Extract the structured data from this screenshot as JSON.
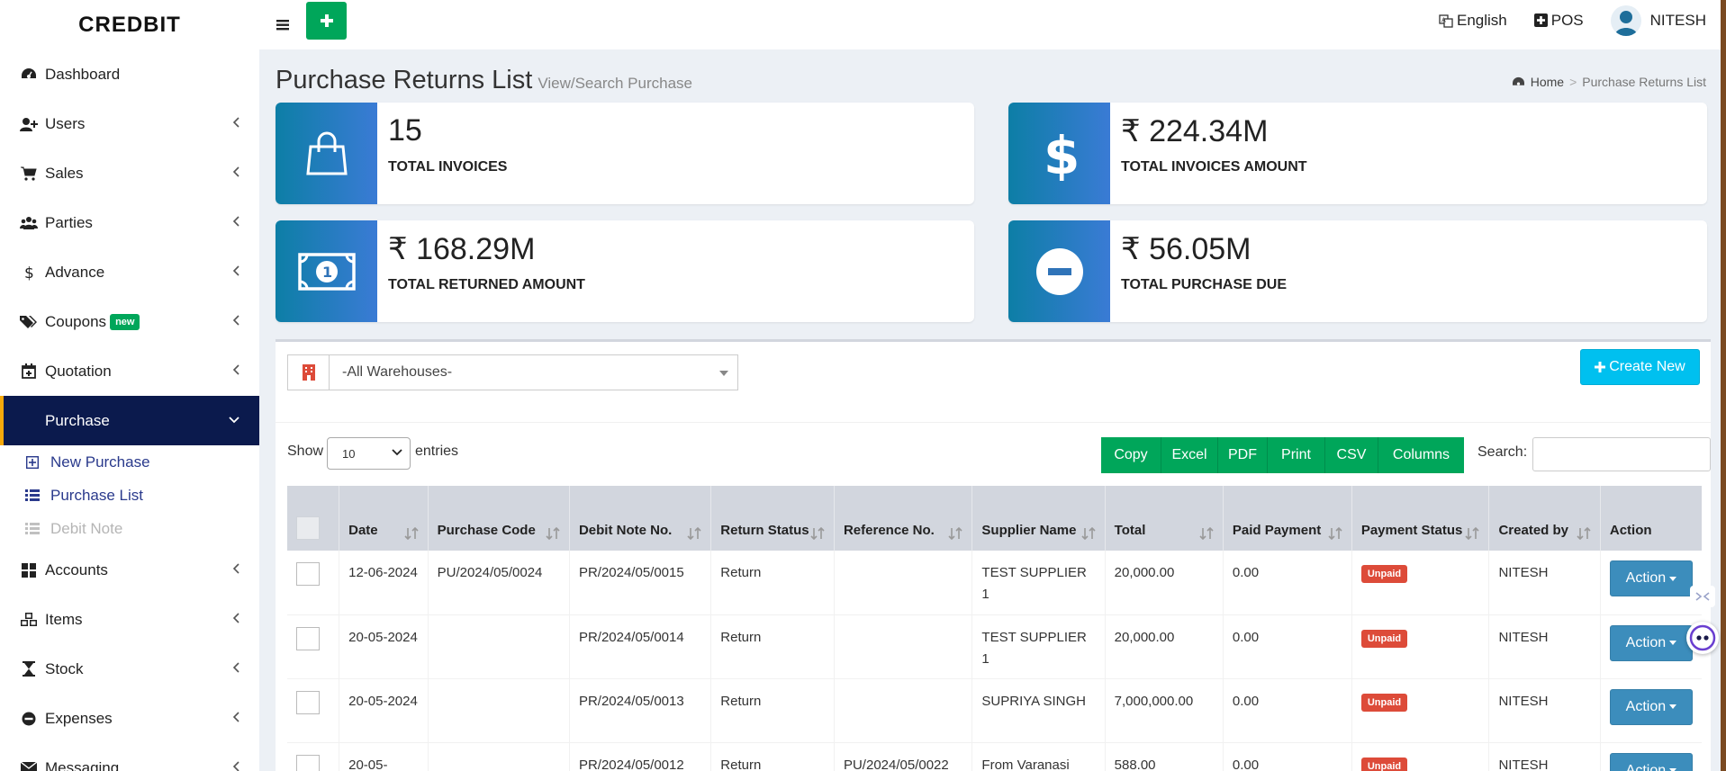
{
  "brand": "CREDBIT",
  "topbar": {
    "language": "English",
    "pos": "POS",
    "user": "NITESH"
  },
  "colors": {
    "accent_green": "#00a65a",
    "sidebar_active": "#0b1a4d",
    "info_blue": "#3a7bd5",
    "unpaid_red": "#dd4b39",
    "action_blue": "#3c8dbc",
    "create_cyan": "#00c0ef"
  },
  "sidebar": {
    "items": [
      {
        "label": "Dashboard",
        "icon": "dashboard-icon"
      },
      {
        "label": "Users",
        "icon": "users-icon"
      },
      {
        "label": "Sales",
        "icon": "cart-icon"
      },
      {
        "label": "Parties",
        "icon": "group-icon"
      },
      {
        "label": "Advance",
        "icon": "dollar-icon"
      },
      {
        "label": "Coupons",
        "icon": "tags-icon",
        "badge": "new"
      },
      {
        "label": "Quotation",
        "icon": "calendar-plus-icon"
      },
      {
        "label": "Purchase",
        "icon": "",
        "active": true
      },
      {
        "label": "Accounts",
        "icon": "grid-icon"
      },
      {
        "label": "Items",
        "icon": "cubes-icon"
      },
      {
        "label": "Stock",
        "icon": "hourglass-icon"
      },
      {
        "label": "Expenses",
        "icon": "minus-circle-icon"
      },
      {
        "label": "Messaging",
        "icon": "envelope-icon"
      }
    ],
    "purchase_sub": [
      {
        "label": "New Purchase",
        "icon": "plus-square-icon"
      },
      {
        "label": "Purchase List",
        "icon": "list-icon"
      },
      {
        "label": "Debit Note",
        "icon": "list-icon"
      }
    ]
  },
  "page": {
    "title": "Purchase Returns List",
    "subtitle": "View/Search Purchase",
    "breadcrumb": {
      "home": "Home",
      "current": "Purchase Returns List"
    }
  },
  "stats": [
    {
      "value": "15",
      "label": "TOTAL INVOICES",
      "icon": "shopping-bag-icon"
    },
    {
      "value": "₹ 224.34M",
      "label": "TOTAL INVOICES AMOUNT",
      "icon": "dollar-icon"
    },
    {
      "value": "₹ 168.29M",
      "label": "TOTAL RETURNED AMOUNT",
      "icon": "money-bill-icon"
    },
    {
      "value": "₹ 56.05M",
      "label": "TOTAL PURCHASE DUE",
      "icon": "minus-circle-icon"
    }
  ],
  "filters": {
    "warehouse": "-All Warehouses-",
    "create_new": "Create New"
  },
  "datatable": {
    "show": "Show",
    "length": "10",
    "entries": "entries",
    "buttons": [
      "Copy",
      "Excel",
      "PDF",
      "Print",
      "CSV",
      "Columns"
    ],
    "search_label": "Search:",
    "search_value": "",
    "columns": [
      "Date",
      "Purchase Code",
      "Debit Note No.",
      "Return Status",
      "Reference No.",
      "Supplier Name",
      "Total",
      "Paid Payment",
      "Payment Status",
      "Created by",
      "Action"
    ],
    "rows": [
      {
        "date": "12-06-2024",
        "purchase_code": "PU/2024/05/0024",
        "debit_note": "PR/2024/05/0015",
        "return_status": "Return",
        "reference": "",
        "supplier": "TEST SUPPLIER 1",
        "total": "20,000.00",
        "paid": "0.00",
        "payment_status": "Unpaid",
        "created_by": "NITESH",
        "action": "Action"
      },
      {
        "date": "20-05-2024",
        "purchase_code": "",
        "debit_note": "PR/2024/05/0014",
        "return_status": "Return",
        "reference": "",
        "supplier": "TEST SUPPLIER 1",
        "total": "20,000.00",
        "paid": "0.00",
        "payment_status": "Unpaid",
        "created_by": "NITESH",
        "action": "Action"
      },
      {
        "date": "20-05-2024",
        "purchase_code": "",
        "debit_note": "PR/2024/05/0013",
        "return_status": "Return",
        "reference": "",
        "supplier": "SUPRIYA SINGH",
        "total": "7,000,000.00",
        "paid": "0.00",
        "payment_status": "Unpaid",
        "created_by": "NITESH",
        "action": "Action"
      },
      {
        "date": "20-05-",
        "purchase_code": "",
        "debit_note": "PR/2024/05/0012",
        "return_status": "Return",
        "reference": "PU/2024/05/0022",
        "supplier": "From Varanasi",
        "total": "588.00",
        "paid": "0.00",
        "payment_status": "Unpaid",
        "created_by": "NITESH",
        "action": "Action"
      }
    ]
  }
}
